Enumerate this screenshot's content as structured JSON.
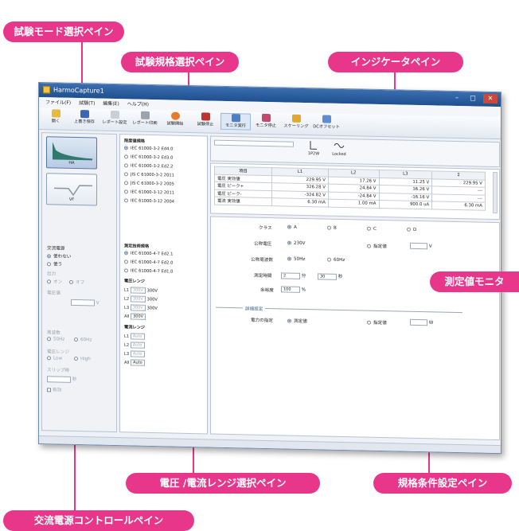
{
  "callouts": {
    "mode_pane": "試験モード選択ペイン",
    "standard_pane": "試験規格選択ペイン",
    "indicator_pane": "インジケータペイン",
    "monitor_pane": "測定値モニタ",
    "range_pane": "電圧 /電流レンジ選択ペイン",
    "condition_pane": "規格条件設定ペイン",
    "ac_power_pane": "交流電源コントロールペイン"
  },
  "window": {
    "title": "HarmoCapture1",
    "menu": [
      "ファイル(F)",
      "試験(T)",
      "編集(E)",
      "ヘルプ(H)"
    ],
    "toolbar": [
      "開く",
      "上書き保存",
      "レポート設定",
      "レポート印刷",
      "試験開始",
      "試験停止",
      "モニタ実行",
      "モニタ停止",
      "スケーリング",
      "DCオフセット"
    ]
  },
  "mode_pane": {
    "btn1": "HA",
    "btn2": "VF",
    "ac_title": "交流電源",
    "ac_off": "使わない",
    "ac_on": "使う",
    "output": "出力",
    "output_on": "オン",
    "output_off": "オフ",
    "voltage": "電圧値",
    "volt_unit": "V",
    "freq": "周波数",
    "hz50": "50Hz",
    "hz60": "60Hz",
    "vrange": "電圧レンジ",
    "low": "Low",
    "high": "High",
    "wait": "スリップ時",
    "sec": "秒",
    "chk": "有効"
  },
  "standard_pane": {
    "harm_title": "限度値規格",
    "harm_items": [
      "IEC 61000-3-2 Ed4.0",
      "IEC 61000-3-2 Ed3.0",
      "IEC 61000-3-2 Ed2.2",
      "JIS C 61000-3-2 2011",
      "JIS C 61000-3-2 2005",
      "IEC 61000-3-12 2011",
      "IEC 61000-3-12 2004"
    ],
    "meas_title": "測定技術規格",
    "meas_items": [
      "IEC 61000-4-7 Ed2.1",
      "IEC 61000-4-7 Ed2.0",
      "IEC 61000-4-7 Ed1.0"
    ],
    "vrange_title": "電圧レンジ",
    "vrange_rows": [
      {
        "ch": "L1",
        "sel": "300V",
        "val": "300V"
      },
      {
        "ch": "L2",
        "sel": "300V",
        "val": "300V"
      },
      {
        "ch": "L3",
        "sel": "300V",
        "val": "300V"
      },
      {
        "ch": "All",
        "sel": "300V",
        "val": ""
      }
    ],
    "irange_title": "電流レンジ",
    "irange_rows": [
      {
        "ch": "L1",
        "sel": "Auto"
      },
      {
        "ch": "L2",
        "sel": "Auto"
      },
      {
        "ch": "L3",
        "sel": "Auto"
      },
      {
        "ch": "All",
        "sel": "Auto"
      }
    ]
  },
  "indicator": {
    "w1": "1P2W",
    "w2": "Locked"
  },
  "monitor": {
    "headers": [
      "項目",
      "L1",
      "L2",
      "L3",
      "Σ"
    ],
    "rows": [
      [
        "電圧 実効値",
        "229.95 V",
        "17.26 V",
        "11.25 V",
        "229.95 V"
      ],
      [
        "電圧 ピーク+",
        "326.28 V",
        "24.84 V",
        "16.26 V",
        "---"
      ],
      [
        "電圧 ピーク-",
        "-324.82 V",
        "-24.84 V",
        "-16.16 V",
        "---"
      ],
      [
        "電流 実効値",
        "6.30 mA",
        "1.00 mA",
        "900.0 uA",
        "6.30 mA"
      ]
    ]
  },
  "conditions": {
    "class_label": "クラス",
    "classes": [
      "A",
      "B",
      "C",
      "D"
    ],
    "nom_v_label": "公称電圧",
    "nom_v": "230V",
    "custom": "指定値",
    "v_unit": "V",
    "nom_f_label": "公称周波数",
    "hz50": "50Hz",
    "hz60": "60Hz",
    "time_label": "測定時間",
    "time_min": "2",
    "min_unit": "分",
    "time_sec": "30",
    "sec_unit": "秒",
    "margin_label": "余裕度",
    "margin_val": "100",
    "pct": "%",
    "detail": "詳細設定",
    "power_label": "電力の指定",
    "measured": "測定値",
    "custom2": "指定値",
    "w_unit": "W"
  },
  "colors": {
    "accent": "#e8368a",
    "titlebar": "#2a5c9e"
  }
}
